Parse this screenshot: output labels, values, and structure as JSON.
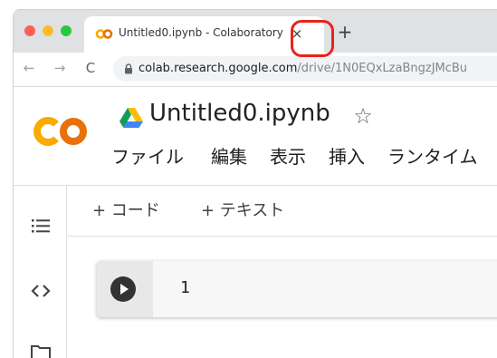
{
  "browser": {
    "tab": {
      "title": "Untitled0.ipynb - Colaboratory",
      "close_glyph": "×",
      "favicon_icon": "colab-icon"
    },
    "new_tab_glyph": "+",
    "nav": {
      "back": "←",
      "forward": "→",
      "reload": "C"
    },
    "url": {
      "host": "colab.research.google.com",
      "path": "/drive/1N0EQxLzaBngzJMcBu"
    },
    "highlight_color": "#e8231a"
  },
  "colab": {
    "doc_title": "Untitled0.ipynb",
    "star_glyph": "☆",
    "menu": [
      "ファイル",
      "編集",
      "表示",
      "挿入",
      "ランタイム"
    ],
    "toolbar": {
      "add_code": "+ コード",
      "add_text": "+ テキスト"
    },
    "sidebar_icons": [
      "toc-icon",
      "code-snippets-icon",
      "folder-icon"
    ],
    "cell": {
      "code": "1"
    },
    "colors": {
      "logo_orange": "#f9ab00",
      "logo_dark_orange": "#e8710a",
      "run_button": "#333333"
    }
  }
}
